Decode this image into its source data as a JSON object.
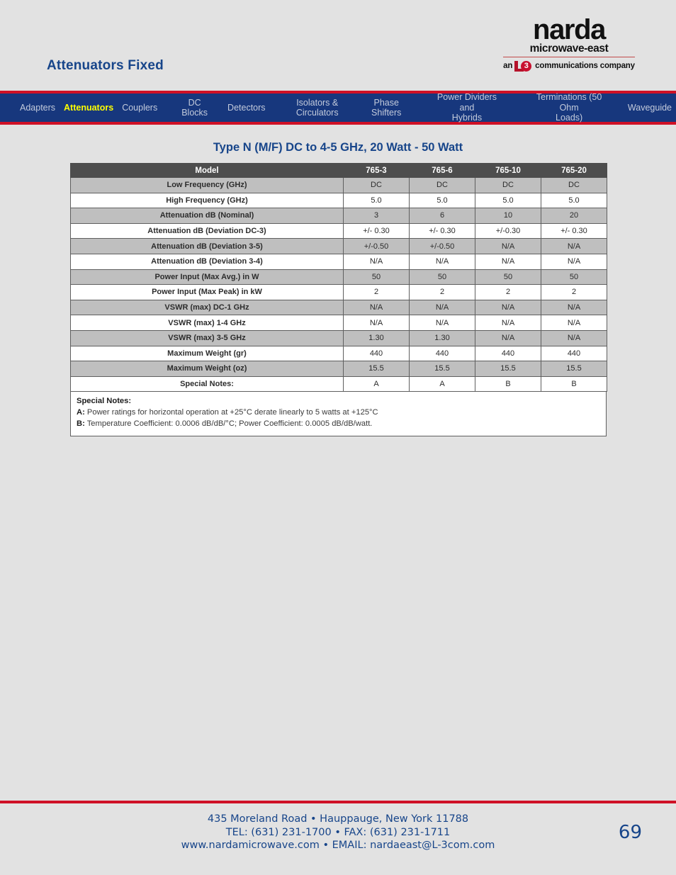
{
  "header": {
    "page_title": "Attenuators Fixed",
    "logo": {
      "brand": "narda",
      "tagline": "microwave-east",
      "affiliation_prefix": "an",
      "affiliation_mark_letter": "L",
      "affiliation_mark_number": "3",
      "affiliation_suffix": "communications company"
    }
  },
  "nav": {
    "items": [
      {
        "label": "Adapters",
        "active": false
      },
      {
        "label": "Attenuators",
        "active": true
      },
      {
        "label": "Couplers",
        "active": false
      },
      {
        "label": "DC\nBlocks",
        "active": false
      },
      {
        "label": "Detectors",
        "active": false
      },
      {
        "label": "Isolators &\nCirculators",
        "active": false
      },
      {
        "label": "Phase\nShifters",
        "active": false
      },
      {
        "label": "Power Dividers and\nHybrids",
        "active": false
      },
      {
        "label": "Terminations (50 Ohm\nLoads)",
        "active": false
      },
      {
        "label": "Waveguide",
        "active": false
      }
    ]
  },
  "section": {
    "title": "Type N (M/F) DC to 4-5 GHz, 20 Watt - 50 Watt"
  },
  "table": {
    "header": [
      "Model",
      "765-3",
      "765-6",
      "765-10",
      "765-20"
    ],
    "rows": [
      {
        "label": "Low Frequency (GHz)",
        "values": [
          "DC",
          "DC",
          "DC",
          "DC"
        ],
        "shaded": true
      },
      {
        "label": "High Frequency (GHz)",
        "values": [
          "5.0",
          "5.0",
          "5.0",
          "5.0"
        ],
        "shaded": false
      },
      {
        "label": "Attenuation dB (Nominal)",
        "values": [
          "3",
          "6",
          "10",
          "20"
        ],
        "shaded": true
      },
      {
        "label": "Attenuation dB (Deviation DC-3)",
        "values": [
          "+/- 0.30",
          "+/- 0.30",
          "+/-0.30",
          "+/- 0.30"
        ],
        "shaded": false
      },
      {
        "label": "Attenuation dB (Deviation 3-5)",
        "values": [
          "+/-0.50",
          "+/-0.50",
          "N/A",
          "N/A"
        ],
        "shaded": true
      },
      {
        "label": "Attenuation dB (Deviation 3-4)",
        "values": [
          "N/A",
          "N/A",
          "N/A",
          "N/A"
        ],
        "shaded": false
      },
      {
        "label": "Power Input (Max Avg.) in W",
        "values": [
          "50",
          "50",
          "50",
          "50"
        ],
        "shaded": true
      },
      {
        "label": "Power Input (Max Peak) in kW",
        "values": [
          "2",
          "2",
          "2",
          "2"
        ],
        "shaded": false
      },
      {
        "label": "VSWR (max) DC-1 GHz",
        "values": [
          "N/A",
          "N/A",
          "N/A",
          "N/A"
        ],
        "shaded": true
      },
      {
        "label": "VSWR (max) 1-4 GHz",
        "values": [
          "N/A",
          "N/A",
          "N/A",
          "N/A"
        ],
        "shaded": false
      },
      {
        "label": "VSWR (max) 3-5 GHz",
        "values": [
          "1.30",
          "1.30",
          "N/A",
          "N/A"
        ],
        "shaded": true
      },
      {
        "label": "Maximum Weight (gr)",
        "values": [
          "440",
          "440",
          "440",
          "440"
        ],
        "shaded": false
      },
      {
        "label": "Maximum Weight (oz)",
        "values": [
          "15.5",
          "15.5",
          "15.5",
          "15.5"
        ],
        "shaded": true
      },
      {
        "label": "Special Notes:",
        "values": [
          "A",
          "A",
          "B",
          "B"
        ],
        "shaded": false
      }
    ]
  },
  "notes": {
    "title": "Special Notes:",
    "a_key": "A:",
    "a_text": " Power ratings for horizontal operation at +25°C derate linearly to 5 watts at +125°C",
    "b_key": "B:",
    "b_text": " Temperature Coefficient: 0.0006 dB/dB/°C; Power Coefficient: 0.0005 dB/dB/watt."
  },
  "footer": {
    "line1": "435 Moreland Road • Hauppauge, New York 11788",
    "line2": "TEL: (631) 231-1700 • FAX: (631) 231-1711",
    "line3": "www.nardamicrowave.com • EMAIL: nardaeast@L-3com.com",
    "page_number": "69"
  },
  "colors": {
    "background": "#e2e2e2",
    "brand_blue": "#17458a",
    "nav_blue": "#17377d",
    "accent_red": "#cf1126",
    "active_tab": "#ffff00",
    "table_header": "#4d4d4d",
    "row_shaded": "#bfbfbf"
  }
}
